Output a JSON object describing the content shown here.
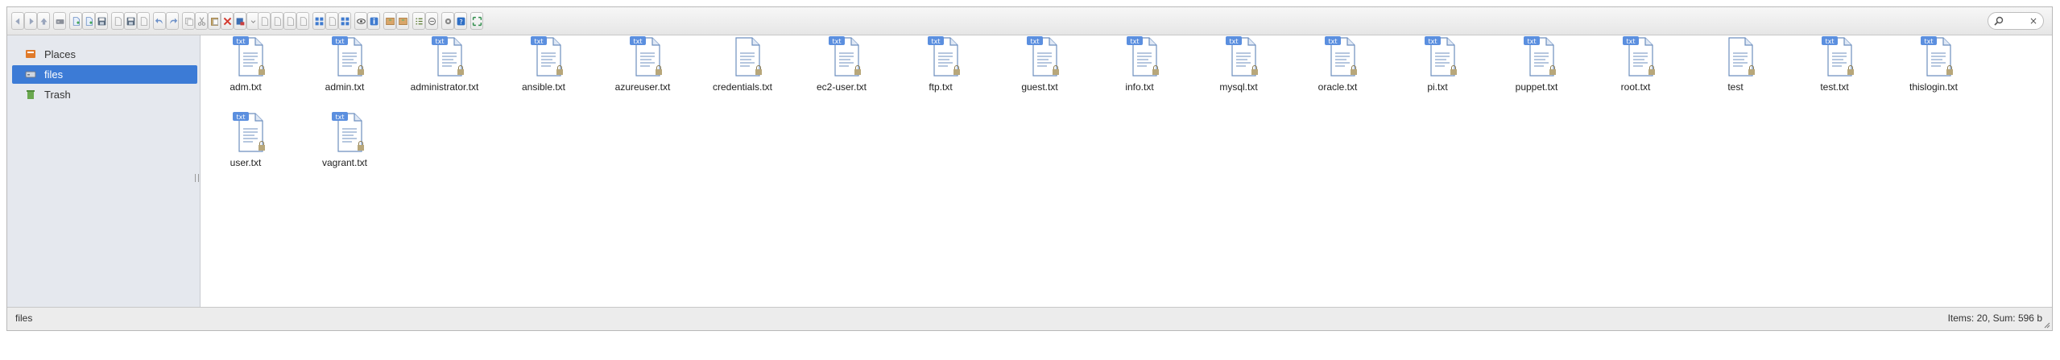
{
  "toolbar": {
    "buttons": [
      {
        "name": "back-button",
        "icon": "arrow-left-icon"
      },
      {
        "name": "forward-button",
        "icon": "arrow-right-icon"
      },
      {
        "name": "up-button",
        "icon": "arrow-up-icon"
      },
      {
        "name": "drive-button",
        "icon": "drive-icon"
      },
      {
        "name": "new-file-button",
        "icon": "new-file-icon"
      },
      {
        "name": "new-folder-button",
        "icon": "new-file-icon"
      },
      {
        "name": "save-button",
        "icon": "save-icon"
      },
      {
        "name": "doc-button",
        "icon": "document-icon"
      },
      {
        "name": "save-as-button",
        "icon": "save-icon"
      },
      {
        "name": "edit-button",
        "icon": "document-icon"
      },
      {
        "name": "undo-button",
        "icon": "undo-icon"
      },
      {
        "name": "redo-button",
        "icon": "redo-icon"
      },
      {
        "name": "copy-button",
        "icon": "copy-icon"
      },
      {
        "name": "cut-button",
        "icon": "cut-icon"
      },
      {
        "name": "paste-button",
        "icon": "paste-icon"
      },
      {
        "name": "delete-button",
        "icon": "delete-icon"
      },
      {
        "name": "rename-button",
        "icon": "rename-icon"
      },
      {
        "name": "more-button",
        "icon": "more-icon"
      },
      {
        "name": "tool-a-button",
        "icon": "document-icon"
      },
      {
        "name": "tool-b-button",
        "icon": "document-icon"
      },
      {
        "name": "tool-c-button",
        "icon": "document-icon"
      },
      {
        "name": "tool-d-button",
        "icon": "document-icon"
      },
      {
        "name": "view-icons-button",
        "icon": "grid-icon"
      },
      {
        "name": "view-list-button",
        "icon": "document-icon"
      },
      {
        "name": "view-tree-button",
        "icon": "grid-icon"
      },
      {
        "name": "preview-button",
        "icon": "eye-icon"
      },
      {
        "name": "info-button",
        "icon": "info-icon"
      },
      {
        "name": "archive-a-button",
        "icon": "archive-icon"
      },
      {
        "name": "archive-b-button",
        "icon": "archive-icon"
      },
      {
        "name": "view-details-button",
        "icon": "list-icon"
      },
      {
        "name": "select-button",
        "icon": "select-icon"
      },
      {
        "name": "settings-button",
        "icon": "gear-icon"
      },
      {
        "name": "help-button",
        "icon": "help-icon"
      },
      {
        "name": "fullscreen-button",
        "icon": "fullscreen-icon"
      }
    ]
  },
  "search": {
    "placeholder": "",
    "value": "",
    "clear_label": "×"
  },
  "sidebar": {
    "items": [
      {
        "label": "Places",
        "icon": "places-icon",
        "selected": false
      },
      {
        "label": "files",
        "icon": "drive-icon",
        "selected": true
      },
      {
        "label": "Trash",
        "icon": "trash-icon",
        "selected": false
      }
    ]
  },
  "files": [
    {
      "name": "adm.txt",
      "badge": "txt"
    },
    {
      "name": "admin.txt",
      "badge": "txt"
    },
    {
      "name": "administrator.txt",
      "badge": "txt"
    },
    {
      "name": "ansible.txt",
      "badge": "txt"
    },
    {
      "name": "azureuser.txt",
      "badge": "txt"
    },
    {
      "name": "credentials.txt",
      "badge": ""
    },
    {
      "name": "ec2-user.txt",
      "badge": "txt"
    },
    {
      "name": "ftp.txt",
      "badge": "txt"
    },
    {
      "name": "guest.txt",
      "badge": "txt"
    },
    {
      "name": "info.txt",
      "badge": "txt"
    },
    {
      "name": "mysql.txt",
      "badge": "txt"
    },
    {
      "name": "oracle.txt",
      "badge": "txt"
    },
    {
      "name": "pi.txt",
      "badge": "txt"
    },
    {
      "name": "puppet.txt",
      "badge": "txt"
    },
    {
      "name": "root.txt",
      "badge": "txt"
    },
    {
      "name": "test",
      "badge": ""
    },
    {
      "name": "test.txt",
      "badge": "txt"
    },
    {
      "name": "thislogin.txt",
      "badge": "txt"
    },
    {
      "name": "user.txt",
      "badge": "txt"
    },
    {
      "name": "vagrant.txt",
      "badge": "txt"
    }
  ],
  "status": {
    "path": "files",
    "summary": "Items: 20, Sum: 596 b"
  },
  "colors": {
    "accent": "#3c7bd6",
    "badge": "#5b8fdf",
    "lock": "#b8a77a"
  }
}
